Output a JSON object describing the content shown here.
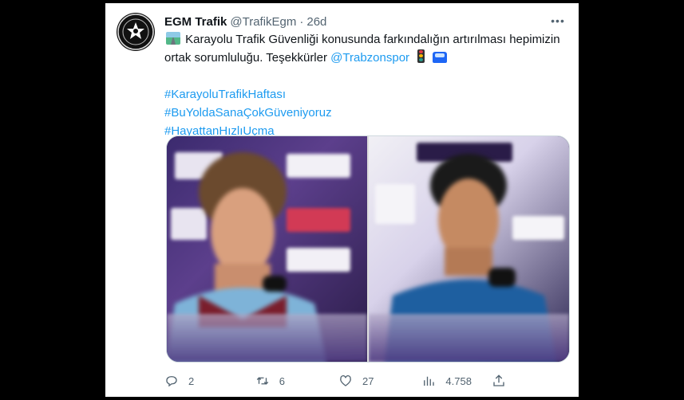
{
  "tweet": {
    "author_name": "EGM Trafik",
    "handle": "@TrafikEgm",
    "separator": "·",
    "time": "26d",
    "more_label": "•••",
    "text_line_before_mention": "Karayolu Trafik Güvenliği konusunda farkındalığın artırılması hepimizin ortak sorumluluğu. Teşekkürler",
    "mention": "@Trabzonspor",
    "hashtags": [
      "#KarayoluTrafikHaftası",
      "#BuYoldaSanaÇokGüveniyoruz",
      "#HayattanHızlıUçma"
    ],
    "emoji": [
      "motorway-emoji",
      "traffic-light-emoji",
      "police-car-emoji"
    ]
  },
  "actions": {
    "replies": "2",
    "retweets": "6",
    "likes": "27",
    "views": "4.758"
  },
  "colors": {
    "link": "#1d9bf0",
    "text": "#0f1419",
    "muted": "#536471",
    "background": "#000000"
  }
}
